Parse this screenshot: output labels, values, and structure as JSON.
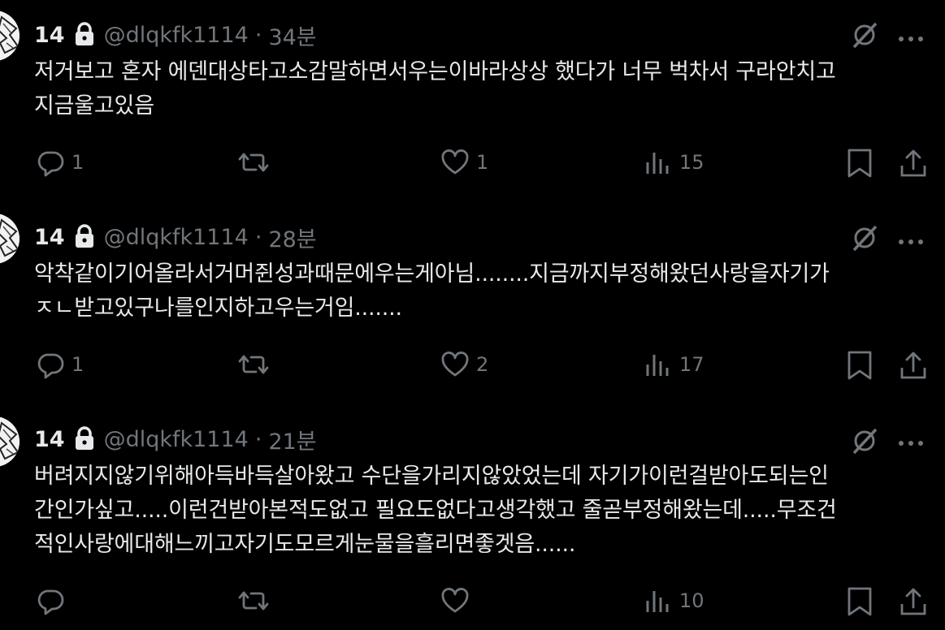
{
  "tweets": [
    {
      "name": "14",
      "handle": "@dlqkfk1114",
      "dot": "·",
      "time": "34분",
      "text": "저거보고 혼자 에덴대상타고소감말하면서우는이바라상상 했다가 너무 벅차서 구라안치고\n지금울고있음",
      "replies": "1",
      "retweets": "",
      "likes": "1",
      "views": "15"
    },
    {
      "name": "14",
      "handle": "@dlqkfk1114",
      "dot": "·",
      "time": "28분",
      "text": "악착같이기어올라서거머쥔성과때문에우는게아님........지금까지부정해왔던사랑을자기가\nㅈㄴ받고있구나를인지하고우는거임.......",
      "replies": "1",
      "retweets": "",
      "likes": "2",
      "views": "17"
    },
    {
      "name": "14",
      "handle": "@dlqkfk1114",
      "dot": "·",
      "time": "21분",
      "text": "버려지지않기위해아득바득살아왔고 수단을가리지않았었는데 자기가이런걸받아도되는인\n간인가싶고.....이런건받아본적도없고 필요도없다고생각했고 줄곧부정해왔는데.....무조건\n적인사랑에대해느끼고자기도모르게눈물을흘리면좋겟음......",
      "replies": "",
      "retweets": "",
      "likes": "",
      "views": "10"
    }
  ],
  "icons": {
    "lock": "lock-icon",
    "grok": "grok-icon",
    "more": "more-icon",
    "reply": "reply-icon",
    "retweet": "retweet-icon",
    "like": "like-icon",
    "views": "views-icon",
    "bookmark": "bookmark-icon",
    "share": "share-icon"
  },
  "colors": {
    "background": "#000000",
    "text": "#e7e9ea",
    "muted": "#71767b"
  }
}
